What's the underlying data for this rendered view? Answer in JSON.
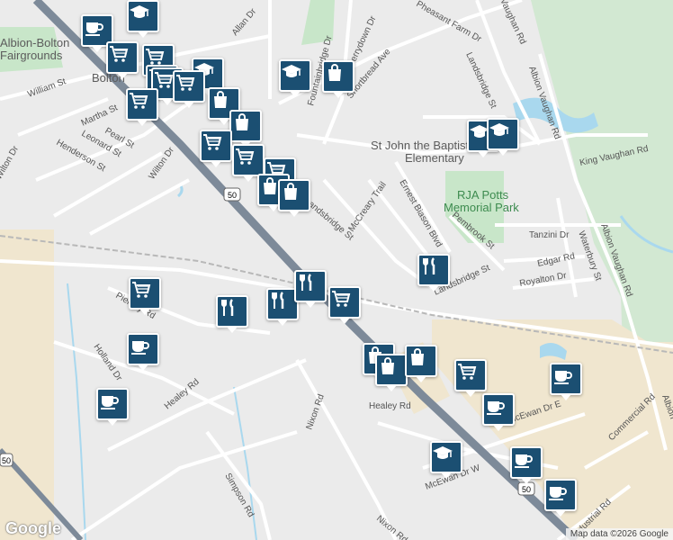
{
  "map": {
    "colors": {
      "base": "#ebebeb",
      "park": "#c8e6c9",
      "industrial": "#f0e6cf",
      "water": "#a9d8ee",
      "road": "#ffffff",
      "highway": "#7d8a99",
      "rail": "#b8b8b8",
      "marker": "#1b4f72"
    },
    "place_labels": {
      "fairgrounds_line1": "Albion-Bolton",
      "fairgrounds_line2": "Fairgrounds",
      "town": "Bolton",
      "school_line1": "St John the Baptist",
      "school_line2": "Elementary",
      "park_line1": "RJA Potts",
      "park_line2": "Memorial Park"
    },
    "street_labels": {
      "allan": "Allan Dr",
      "william": "William St",
      "martha": "Martha St",
      "pearl": "Pearl St",
      "leonard": "Leonard St",
      "henderson": "Henderson St",
      "wilton_left": "Wilton Dr",
      "wilton": "Wilton Dr",
      "fountainbridge": "Fountainbridge Dr",
      "berrydown": "Berrydown Dr",
      "shortbread": "Shortbread Ave",
      "pheasant_farm": "Pheasant Farm Dr",
      "vaughan_top": "Vaughan Rd",
      "albion_vaughan_upper": "Albion Vaughan Rd",
      "landsbridge_north": "Landsbridge St",
      "king_vaughan": "King Vaughan Rd",
      "landsbridge": "Landsbridge St",
      "mccreary": "McCreary Trail",
      "ernest_biason": "Ernest Biason Blvd",
      "pembrook": "Pembrook St",
      "tanzini": "Tanzini Dr",
      "edgar": "Edgar Rd",
      "waterbury": "Waterbury St",
      "royalton": "Royalton Dr",
      "landsbridge_south": "Landsbridge St",
      "albion_vaughan_lower": "Albion Vaughan Rd",
      "piercey": "Piercey Rd",
      "holland": "Holland Dr",
      "healey": "Healey Rd",
      "healey_east": "Healey Rd",
      "nixon": "Nixon Rd",
      "simpson": "Simpson Rd",
      "nixon_south": "Nixon Rd",
      "mcewan": "McEwan Dr W",
      "mcewan_e": "McEwan Dr E",
      "commercial": "Commercial Rd",
      "industrial": "Industrial Rd",
      "albion_vaughan_edge": "Albion",
      "hwy50_shield_top": "50",
      "hwy50_shield_bottom": "50",
      "hwy50_shield_left": "50"
    },
    "markers": [
      {
        "type": "coffee",
        "icon": "coffee-icon"
      },
      {
        "type": "school",
        "icon": "graduation-cap-icon"
      },
      {
        "type": "shopping",
        "icon": "shopping-cart-icon"
      },
      {
        "type": "shopping",
        "icon": "shopping-cart-icon"
      },
      {
        "type": "shopping",
        "icon": "shopping-cart-icon"
      },
      {
        "type": "school",
        "icon": "graduation-cap-icon"
      },
      {
        "type": "shopping",
        "icon": "shopping-cart-icon"
      },
      {
        "type": "shopping",
        "icon": "shopping-cart-icon"
      },
      {
        "type": "shopping",
        "icon": "shopping-cart-icon"
      },
      {
        "type": "school",
        "icon": "graduation-cap-icon"
      },
      {
        "type": "store",
        "icon": "shopping-bag-icon"
      },
      {
        "type": "store",
        "icon": "shopping-bag-icon"
      },
      {
        "type": "store",
        "icon": "shopping-bag-icon"
      },
      {
        "type": "shopping",
        "icon": "shopping-cart-icon"
      },
      {
        "type": "shopping",
        "icon": "shopping-cart-icon"
      },
      {
        "type": "school",
        "icon": "graduation-cap-icon"
      },
      {
        "type": "school",
        "icon": "graduation-cap-icon"
      },
      {
        "type": "shopping",
        "icon": "shopping-cart-icon"
      },
      {
        "type": "store",
        "icon": "shopping-bag-icon"
      },
      {
        "type": "store",
        "icon": "shopping-bag-icon"
      },
      {
        "type": "restaurant",
        "icon": "fork-knife-icon"
      },
      {
        "type": "shopping",
        "icon": "shopping-cart-icon"
      },
      {
        "type": "restaurant",
        "icon": "fork-knife-icon"
      },
      {
        "type": "restaurant",
        "icon": "fork-knife-icon"
      },
      {
        "type": "restaurant",
        "icon": "fork-knife-icon"
      },
      {
        "type": "shopping",
        "icon": "shopping-cart-icon"
      },
      {
        "type": "coffee",
        "icon": "coffee-icon"
      },
      {
        "type": "coffee",
        "icon": "coffee-icon"
      },
      {
        "type": "store",
        "icon": "shopping-bag-icon"
      },
      {
        "type": "store",
        "icon": "shopping-bag-icon"
      },
      {
        "type": "store",
        "icon": "shopping-bag-icon"
      },
      {
        "type": "shopping",
        "icon": "shopping-cart-icon"
      },
      {
        "type": "coffee",
        "icon": "coffee-icon"
      },
      {
        "type": "coffee",
        "icon": "coffee-icon"
      },
      {
        "type": "school",
        "icon": "graduation-cap-icon"
      },
      {
        "type": "coffee",
        "icon": "coffee-icon"
      },
      {
        "type": "coffee",
        "icon": "coffee-icon"
      }
    ]
  },
  "branding": {
    "logo": "Google",
    "attribution": "Map data ©2026 Google"
  }
}
